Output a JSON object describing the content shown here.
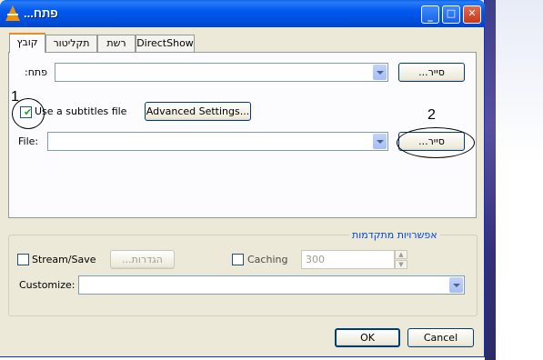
{
  "window": {
    "title": "פתח...",
    "tabs": [
      "קובץ",
      "תקליטור",
      "רשת",
      "DirectShow"
    ],
    "active_tab": 0
  },
  "file_tab": {
    "open_label": "פתח:",
    "open_value": "",
    "browse_label": "סייר...",
    "subtitles_checkbox_label": "Use a subtitles file",
    "subtitles_checked": true,
    "advanced_settings_label": "Advanced Settings...",
    "file_label": "File:",
    "file_value": "",
    "file_browse_label": "סייר..."
  },
  "advanced": {
    "group_title": "אפשרויות מתקדמות",
    "stream_save_label": "Stream/Save",
    "stream_save_checked": false,
    "settings_button_label": "הגדרות...",
    "caching_label": "Caching",
    "caching_checked": false,
    "caching_value": "300",
    "customize_label": "Customize:",
    "customize_value": ""
  },
  "footer": {
    "ok_label": "OK",
    "cancel_label": "Cancel"
  },
  "annotations": {
    "marker_1": "1",
    "marker_2": "2"
  },
  "colors": {
    "titlebar": "#0058ee",
    "window_bg": "#ece9d8",
    "active_tab_accent": "#e68b2c",
    "group_title": "#0046d5"
  }
}
